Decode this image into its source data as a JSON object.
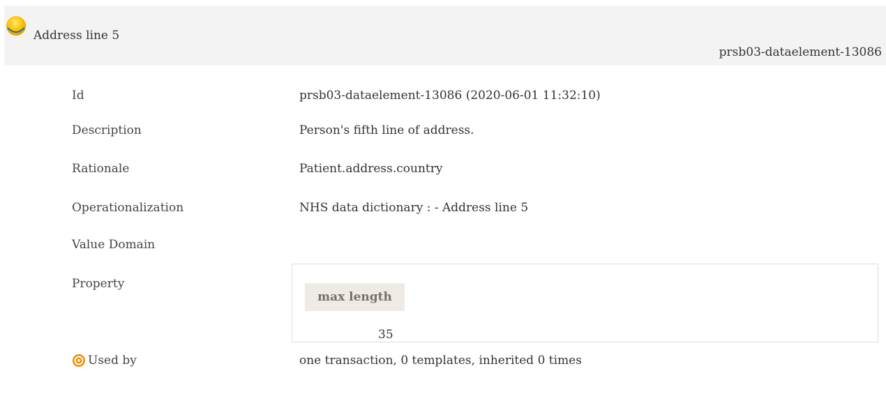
{
  "header": {
    "title": "Address line 5",
    "id_label": "prsb03-dataelement-13086",
    "status_icon": "status-dot-icon",
    "status_color": "#f5b800"
  },
  "details": {
    "id": {
      "label": "Id",
      "value": "prsb03-dataelement-13086 (2020-06-01 11:32:10)"
    },
    "description": {
      "label": "Description",
      "value": "Person's fifth line of address."
    },
    "rationale": {
      "label": "Rationale",
      "value": "Patient.address.country"
    },
    "operationalization": {
      "label": "Operationalization",
      "value": "NHS data dictionary : - Address line 5"
    },
    "value_domain": {
      "label": "Value Domain"
    },
    "property": {
      "label": "Property",
      "column_header": "max length",
      "value": "35"
    },
    "used_by": {
      "label": "Used by",
      "icon": "target-icon",
      "icon_color": "#f08a00",
      "value": "one transaction, 0 templates, inherited 0 times"
    }
  }
}
